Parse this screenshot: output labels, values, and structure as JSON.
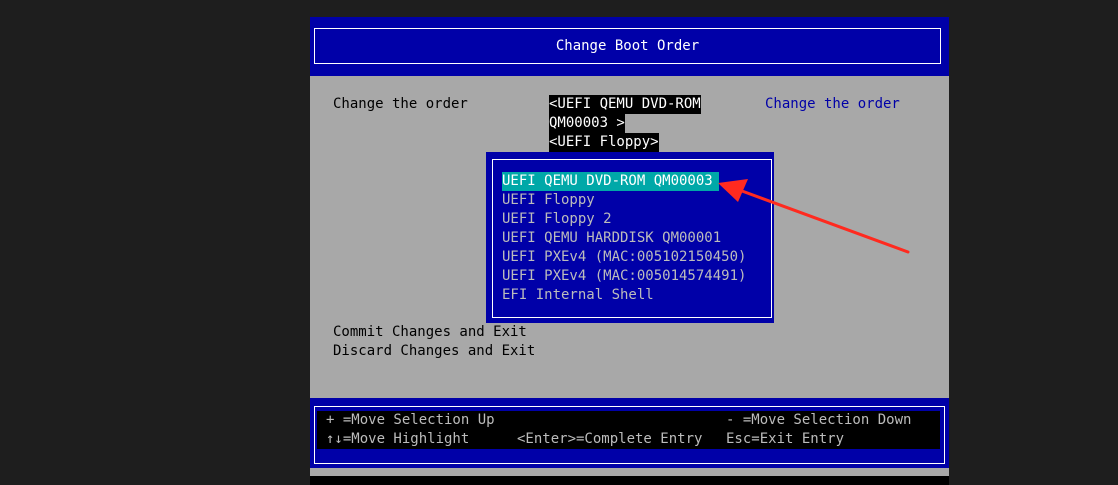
{
  "title": "Change Boot Order",
  "form": {
    "prompt": "Change the order",
    "help_text": "Change the order",
    "current_value_lines": [
      "<UEFI QEMU DVD-ROM",
      "QM00003 >",
      "<UEFI Floppy>"
    ],
    "commit_label": "Commit Changes and Exit",
    "discard_label": "Discard Changes and Exit"
  },
  "popup": {
    "items": [
      "UEFI QEMU DVD-ROM QM00003",
      "UEFI Floppy",
      "UEFI Floppy 2",
      "UEFI QEMU HARDDISK QM00001",
      "UEFI PXEv4 (MAC:005102150450)",
      "UEFI PXEv4 (MAC:005014574491)",
      "EFI Internal Shell"
    ],
    "selected_index": 0
  },
  "footer": {
    "move_up": "+ =Move Selection Up",
    "move_down": "- =Move Selection Down",
    "move_highlight": "↑↓=Move Highlight",
    "complete_entry": "<Enter>=Complete Entry",
    "exit_entry": "Esc=Exit Entry"
  },
  "annotation": {
    "icon": "red-arrow-icon",
    "color": "#ff2a1f"
  },
  "colors": {
    "bios_blue": "#0000a8",
    "bios_gray": "#a8a8a8",
    "highlight_cyan": "#00a8a8"
  }
}
